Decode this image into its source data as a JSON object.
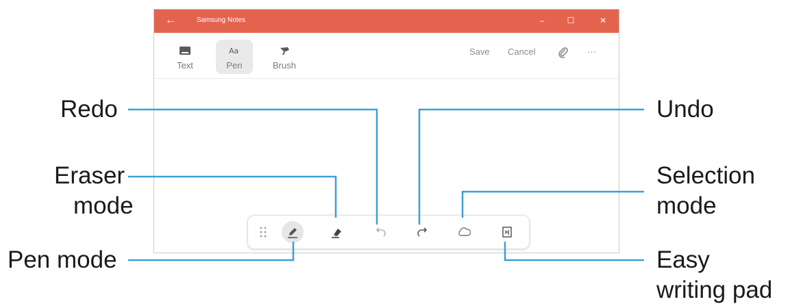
{
  "window": {
    "title": "Samsung Notes",
    "back_icon": "arrow-left-icon",
    "minimize_label": "–",
    "maximize_label": "☐",
    "close_label": "✕",
    "accent": "#e4634f"
  },
  "toolbar": {
    "tools": [
      {
        "label": "Text",
        "icon": "keyboard-icon"
      },
      {
        "label": "Pen",
        "icon": "pen-text-icon",
        "active": true
      },
      {
        "label": "Brush",
        "icon": "brush-icon"
      }
    ],
    "save_label": "Save",
    "cancel_label": "Cancel",
    "attach_icon": "paperclip-icon",
    "more_label": "···"
  },
  "pen_bar": {
    "buttons": [
      "drag-handle-icon",
      "pen-icon",
      "eraser-icon",
      "undo-icon",
      "redo-icon",
      "lasso-icon",
      "writing-pad-icon"
    ],
    "active": "pen-icon"
  },
  "callouts": {
    "redo": "Redo",
    "undo": "Undo",
    "eraser_line1": "Eraser",
    "eraser_line2": "mode",
    "selection_line1": "Selection",
    "selection_line2": "mode",
    "pen_mode": "Pen mode",
    "easy_line1": "Easy",
    "easy_line2": "writing pad",
    "leader_color": "#3aa0d6"
  }
}
